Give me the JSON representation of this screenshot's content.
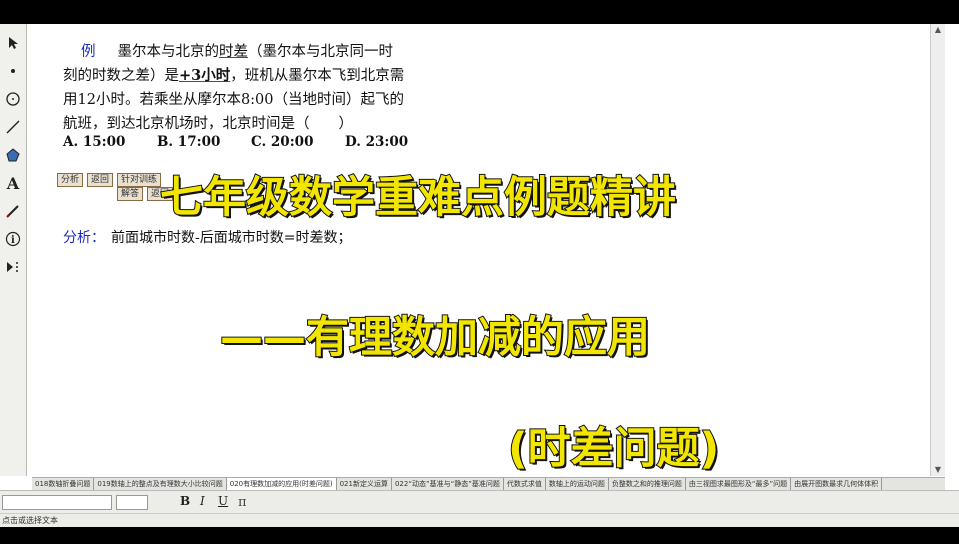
{
  "problem": {
    "label": "例",
    "line1_a": "墨尔本与北京的",
    "line1_u": "时差",
    "line1_b": "（墨尔本与北京同一时",
    "line2_a": "刻的时数之差）是",
    "line2_u": "+3小时",
    "line2_b": "，班机从墨尔本飞到北京需",
    "line3": "用12小时。若乘坐从摩尔本8:00（当地时间）起飞的",
    "line4": "航班，到达北京机场时，北京时间是（　　）"
  },
  "choices": [
    "A. 15:00",
    "B. 17:00",
    "C. 20:00",
    "D. 23:00"
  ],
  "buttons": {
    "analyze": "分析",
    "back1": "返回",
    "check": "针对训练",
    "solve": "解答",
    "back2": "返回"
  },
  "analysis": {
    "label": "分析：",
    "text": "前面城市时数-后面城市时数=时差数；"
  },
  "overlay": {
    "title": "七年级数学重难点例题精讲",
    "subtitle": "——有理数加减的应用",
    "topic": "(时差问题)"
  },
  "tabs": [
    "018数轴折叠问题",
    "019数轴上的整点及有理数大小比较问题",
    "020有理数加减的应用(时差问题)",
    "021新定义运算",
    "022“动态”基准与“静态”基准问题",
    "代数式求值",
    "数轴上的运动问题",
    "负整数之和的推理问题",
    "由三视图求最图形及“最多”问题",
    "由展开图数最求几何体体积"
  ],
  "format": {
    "bold": "B",
    "italic": "I",
    "underline": "U"
  },
  "status": "点击或选择文本"
}
